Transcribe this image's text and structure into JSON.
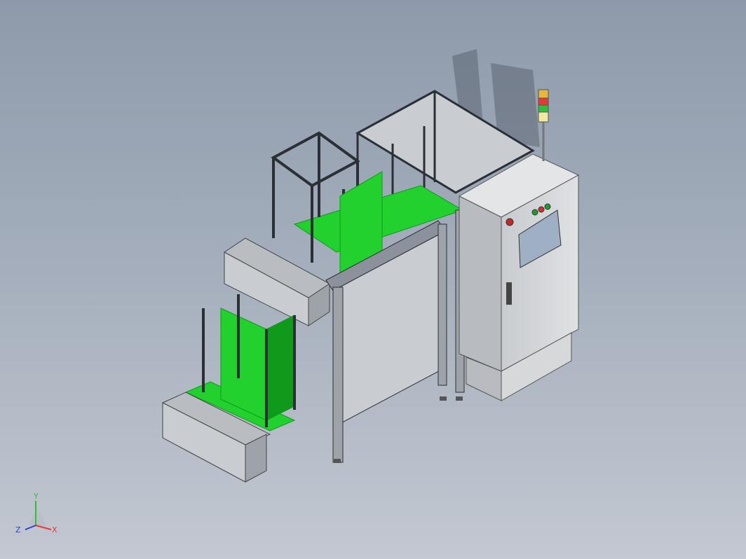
{
  "triad": {
    "x_label": "X",
    "y_label": "Y",
    "z_label": "Z",
    "x_color": "#e53935",
    "y_color": "#2fbf3a",
    "z_color": "#2b3fd9"
  },
  "colors": {
    "frame": "#2b2f36",
    "frame_light": "#8b929b",
    "panel": "#c9ccd0",
    "panel_dark": "#9ea3a9",
    "green": "#22d12e",
    "green_dark": "#0f9a1c",
    "cabinet": "#d3d5d8",
    "screen": "#9fb0c4"
  },
  "stack_light": [
    "red",
    "green",
    "yellow"
  ],
  "control_buttons": [
    "green-button",
    "red-button",
    "green-button"
  ]
}
